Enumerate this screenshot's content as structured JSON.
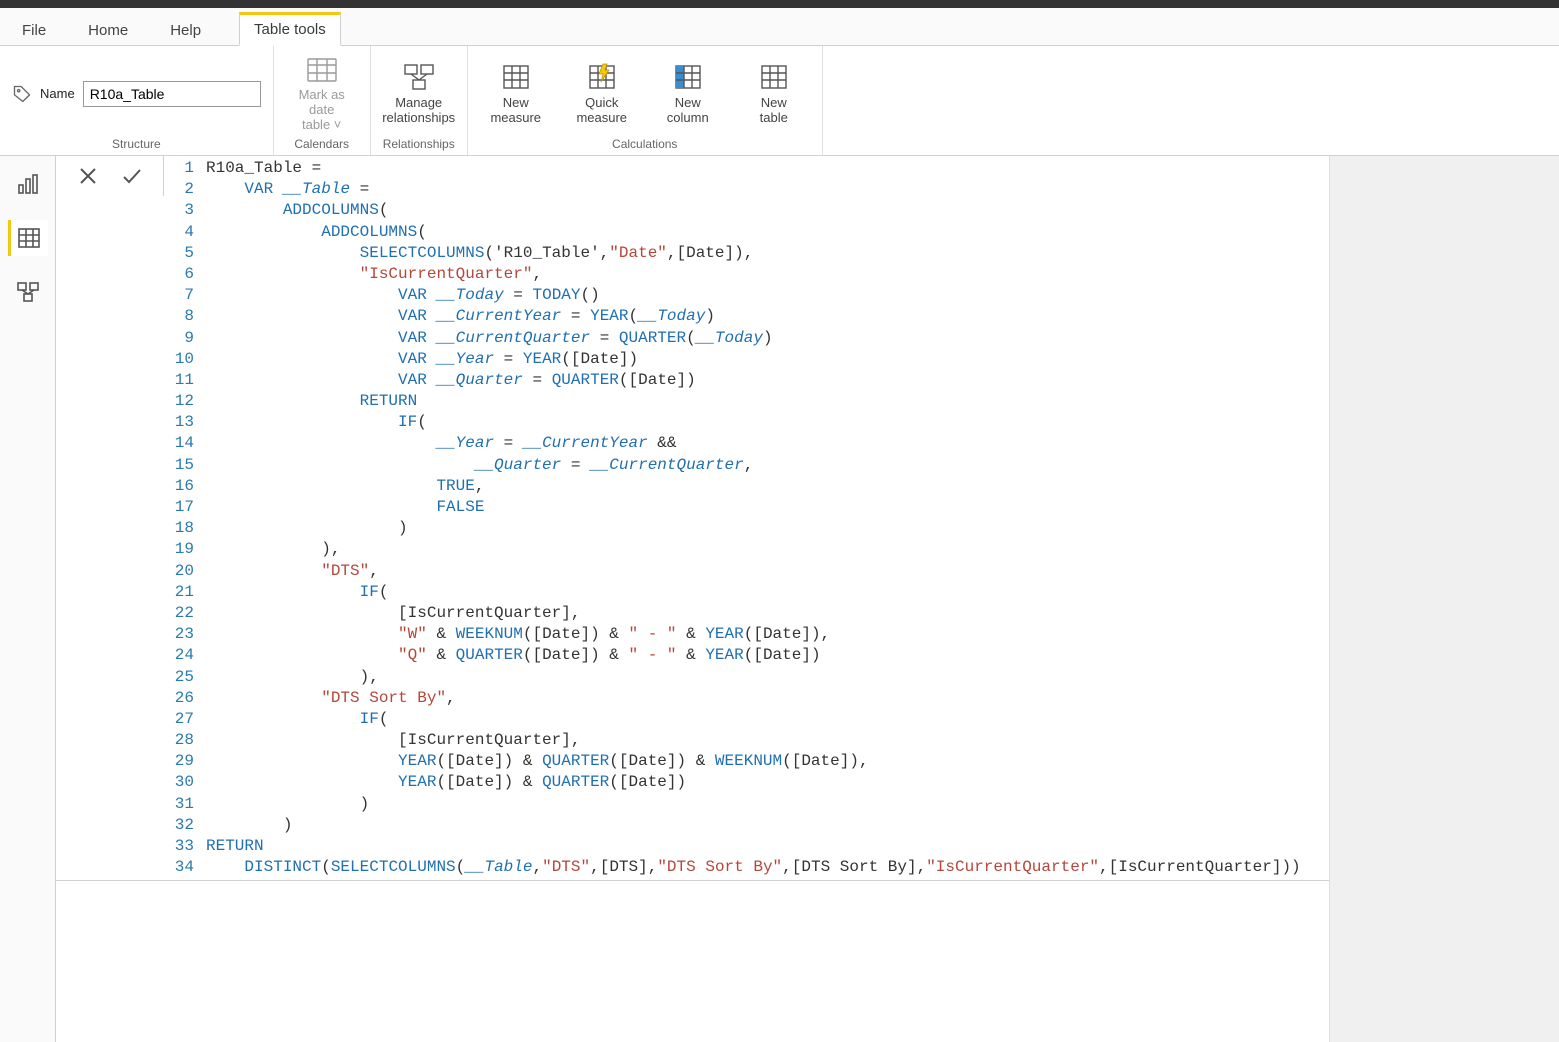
{
  "tabs": {
    "file": "File",
    "home": "Home",
    "help": "Help",
    "tabletools": "Table tools"
  },
  "structure": {
    "name_label": "Name",
    "name_value": "R10a_Table",
    "group_label": "Structure"
  },
  "calendars": {
    "mark_date_line1": "Mark as date",
    "mark_date_line2": "table ˅",
    "group_label": "Calendars"
  },
  "relationships": {
    "manage_line1": "Manage",
    "manage_line2": "relationships",
    "group_label": "Relationships"
  },
  "calculations": {
    "new_measure_line1": "New",
    "new_measure_line2": "measure",
    "quick_measure_line1": "Quick",
    "quick_measure_line2": "measure",
    "new_column_line1": "New",
    "new_column_line2": "column",
    "new_table_line1": "New",
    "new_table_line2": "table",
    "group_label": "Calculations"
  },
  "code_lines": [
    {
      "n": "1",
      "html": "<span class='txt'>R10a_Table = </span>"
    },
    {
      "n": "2",
      "html": "    <span class='kw'>VAR</span> <span class='id'>__Table</span> <span class='txt'>=</span>"
    },
    {
      "n": "3",
      "html": "        <span class='fn'>ADDCOLUMNS</span><span class='txt'>(</span>"
    },
    {
      "n": "4",
      "html": "            <span class='fn'>ADDCOLUMNS</span><span class='txt'>(</span>"
    },
    {
      "n": "5",
      "html": "                <span class='fn'>SELECTCOLUMNS</span><span class='txt'>('R10_Table',</span><span class='str'>\"Date\"</span><span class='txt'>,[Date]),</span>"
    },
    {
      "n": "6",
      "html": "                <span class='str'>\"IsCurrentQuarter\"</span><span class='txt'>,</span>"
    },
    {
      "n": "7",
      "html": "                    <span class='kw'>VAR</span> <span class='id'>__Today</span> <span class='txt'>= </span><span class='fn'>TODAY</span><span class='txt'>()</span>"
    },
    {
      "n": "8",
      "html": "                    <span class='kw'>VAR</span> <span class='id'>__CurrentYear</span> <span class='txt'>= </span><span class='fn'>YEAR</span><span class='txt'>(</span><span class='id'>__Today</span><span class='txt'>)</span>"
    },
    {
      "n": "9",
      "html": "                    <span class='kw'>VAR</span> <span class='id'>__CurrentQuarter</span> <span class='txt'>= </span><span class='fn'>QUARTER</span><span class='txt'>(</span><span class='id'>__Today</span><span class='txt'>)</span>"
    },
    {
      "n": "10",
      "html": "                    <span class='kw'>VAR</span> <span class='id'>__Year</span> <span class='txt'>= </span><span class='fn'>YEAR</span><span class='txt'>([Date])</span>"
    },
    {
      "n": "11",
      "html": "                    <span class='kw'>VAR</span> <span class='id'>__Quarter</span> <span class='txt'>= </span><span class='fn'>QUARTER</span><span class='txt'>([Date])</span>"
    },
    {
      "n": "12",
      "html": "                <span class='kw'>RETURN</span>"
    },
    {
      "n": "13",
      "html": "                    <span class='fn'>IF</span><span class='txt'>(</span>"
    },
    {
      "n": "14",
      "html": "                        <span class='id'>__Year</span> <span class='txt'>= </span><span class='id'>__CurrentYear</span> <span class='txt'>&amp;&amp;</span>"
    },
    {
      "n": "15",
      "html": "                            <span class='id'>__Quarter</span> <span class='txt'>= </span><span class='id'>__CurrentQuarter</span><span class='txt'>,</span>"
    },
    {
      "n": "16",
      "html": "                        <span class='kw'>TRUE</span><span class='txt'>,</span>"
    },
    {
      "n": "17",
      "html": "                        <span class='kw'>FALSE</span>"
    },
    {
      "n": "18",
      "html": "                    <span class='txt'>)</span>"
    },
    {
      "n": "19",
      "html": "            <span class='txt'>),</span>"
    },
    {
      "n": "20",
      "html": "            <span class='str'>\"DTS\"</span><span class='txt'>,</span>"
    },
    {
      "n": "21",
      "html": "                <span class='fn'>IF</span><span class='txt'>(</span>"
    },
    {
      "n": "22",
      "html": "                    <span class='txt'>[IsCurrentQuarter],</span>"
    },
    {
      "n": "23",
      "html": "                    <span class='str'>\"W\"</span> <span class='txt'>&amp; </span><span class='fn'>WEEKNUM</span><span class='txt'>([Date]) &amp; </span><span class='str'>\" - \"</span><span class='txt'> &amp; </span><span class='fn'>YEAR</span><span class='txt'>([Date]),</span>"
    },
    {
      "n": "24",
      "html": "                    <span class='str'>\"Q\"</span> <span class='txt'>&amp; </span><span class='fn'>QUARTER</span><span class='txt'>([Date]) &amp; </span><span class='str'>\" - \"</span><span class='txt'> &amp; </span><span class='fn'>YEAR</span><span class='txt'>([Date])</span>"
    },
    {
      "n": "25",
      "html": "                <span class='txt'>),</span>"
    },
    {
      "n": "26",
      "html": "            <span class='str'>\"DTS Sort By\"</span><span class='txt'>,</span>"
    },
    {
      "n": "27",
      "html": "                <span class='fn'>IF</span><span class='txt'>(</span>"
    },
    {
      "n": "28",
      "html": "                    <span class='txt'>[IsCurrentQuarter],</span>"
    },
    {
      "n": "29",
      "html": "                    <span class='fn'>YEAR</span><span class='txt'>([Date]) &amp; </span><span class='fn'>QUARTER</span><span class='txt'>([Date]) &amp; </span><span class='fn'>WEEKNUM</span><span class='txt'>([Date]),</span>"
    },
    {
      "n": "30",
      "html": "                    <span class='fn'>YEAR</span><span class='txt'>([Date]) &amp; </span><span class='fn'>QUARTER</span><span class='txt'>([Date])</span>"
    },
    {
      "n": "31",
      "html": "                <span class='txt'>)</span>"
    },
    {
      "n": "32",
      "html": "        <span class='txt'>)</span>"
    },
    {
      "n": "33",
      "html": "<span class='kw'>RETURN</span>"
    },
    {
      "n": "34",
      "html": "    <span class='fn'>DISTINCT</span><span class='txt'>(</span><span class='fn'>SELECTCOLUMNS</span><span class='txt'>(</span><span class='id'>__Table</span><span class='txt'>,</span><span class='str'>\"DTS\"</span><span class='txt'>,[DTS],</span><span class='str'>\"DTS Sort By\"</span><span class='txt'>,[DTS Sort By],</span><span class='str'>\"IsCurrentQuarter\"</span><span class='txt'>,[IsCurrentQuarter]))</span>"
    }
  ]
}
